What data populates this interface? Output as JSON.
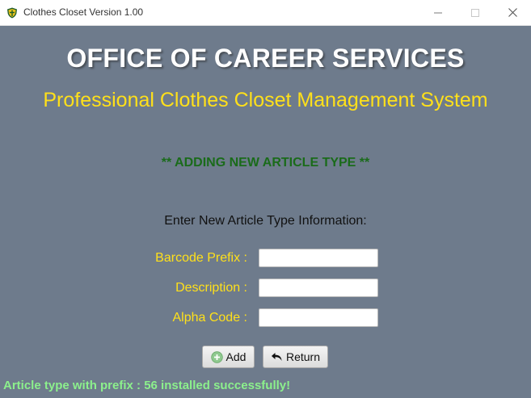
{
  "window": {
    "title": "Clothes Closet Version 1.00",
    "icon": "shield-icon",
    "controls": [
      "minimize-icon",
      "maximize-icon",
      "close-icon"
    ]
  },
  "header": {
    "title": "OFFICE OF CAREER SERVICES",
    "subtitle": "Professional Clothes Closet Management System"
  },
  "section": {
    "title": "** ADDING NEW ARTICLE TYPE **"
  },
  "form": {
    "prompt": "Enter New Article Type Information:",
    "fields": [
      {
        "label": "Barcode Prefix :",
        "value": ""
      },
      {
        "label": "Description :",
        "value": ""
      },
      {
        "label": "Alpha Code :",
        "value": ""
      }
    ],
    "buttons": {
      "add": {
        "label": "Add",
        "icon": "plus-circle-icon"
      },
      "return": {
        "label": "Return",
        "icon": "return-arrow-icon"
      }
    }
  },
  "status": {
    "message": "Article type with prefix : 56 installed successfully!"
  },
  "colors": {
    "background": "#6e7b8c",
    "title": "#ffffff",
    "subtitle": "#ffe01a",
    "section_title": "#1a6b1a",
    "labels": "#ffe01a",
    "status": "#8cf08c"
  }
}
